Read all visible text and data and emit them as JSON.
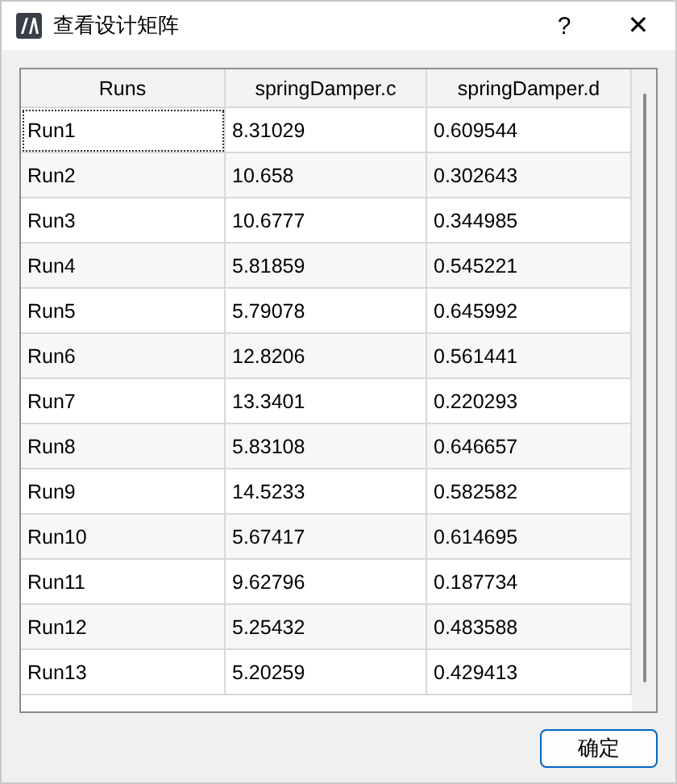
{
  "window": {
    "title": "查看设计矩阵",
    "help": "?",
    "close": "✕"
  },
  "table": {
    "columns": [
      "Runs",
      "springDamper.c",
      "springDamper.d"
    ],
    "rows": [
      {
        "cells": [
          "Run1",
          "8.31029",
          "0.609544"
        ],
        "focused": true
      },
      {
        "cells": [
          "Run2",
          "10.658",
          "0.302643"
        ],
        "focused": false
      },
      {
        "cells": [
          "Run3",
          "10.6777",
          "0.344985"
        ],
        "focused": false
      },
      {
        "cells": [
          "Run4",
          "5.81859",
          "0.545221"
        ],
        "focused": false
      },
      {
        "cells": [
          "Run5",
          "5.79078",
          "0.645992"
        ],
        "focused": false
      },
      {
        "cells": [
          "Run6",
          "12.8206",
          "0.561441"
        ],
        "focused": false
      },
      {
        "cells": [
          "Run7",
          "13.3401",
          "0.220293"
        ],
        "focused": false
      },
      {
        "cells": [
          "Run8",
          "5.83108",
          "0.646657"
        ],
        "focused": false
      },
      {
        "cells": [
          "Run9",
          "14.5233",
          "0.582582"
        ],
        "focused": false
      },
      {
        "cells": [
          "Run10",
          "5.67417",
          "0.614695"
        ],
        "focused": false
      },
      {
        "cells": [
          "Run11",
          "9.62796",
          "0.187734"
        ],
        "focused": false
      },
      {
        "cells": [
          "Run12",
          "5.25432",
          "0.483588"
        ],
        "focused": false
      },
      {
        "cells": [
          "Run13",
          "5.20259",
          "0.429413"
        ],
        "focused": false
      }
    ]
  },
  "buttons": [
    "确定"
  ]
}
